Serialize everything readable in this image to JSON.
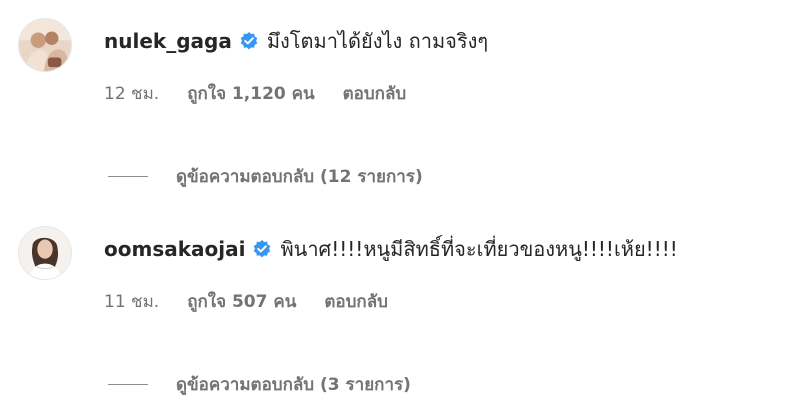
{
  "comments": [
    {
      "username": "nulek_gaga",
      "text": "มึงโตมาได้ยังไง ถามจริงๆ",
      "time": "12 ชม.",
      "likes": "ถูกใจ 1,120 คน",
      "reply": "ตอบกลับ",
      "view_replies": "ดูข้อความตอบกลับ (12 รายการ)"
    },
    {
      "username": "oomsakaojai",
      "text": "พินาศ!!!!หนูมีสิทธิ์ที่จะเที่ยวของหนู!!!!เห้ย!!!!",
      "time": "11 ชม.",
      "likes": "ถูกใจ 507 คน",
      "reply": "ตอบกลับ",
      "view_replies": "ดูข้อความตอบกลับ (3 รายการ)"
    }
  ],
  "colors": {
    "verified": "#3897f0",
    "text": "#262626",
    "secondary": "#737373"
  },
  "icons": {
    "verified": "verified-badge-icon",
    "avatar": "avatar-photo"
  }
}
